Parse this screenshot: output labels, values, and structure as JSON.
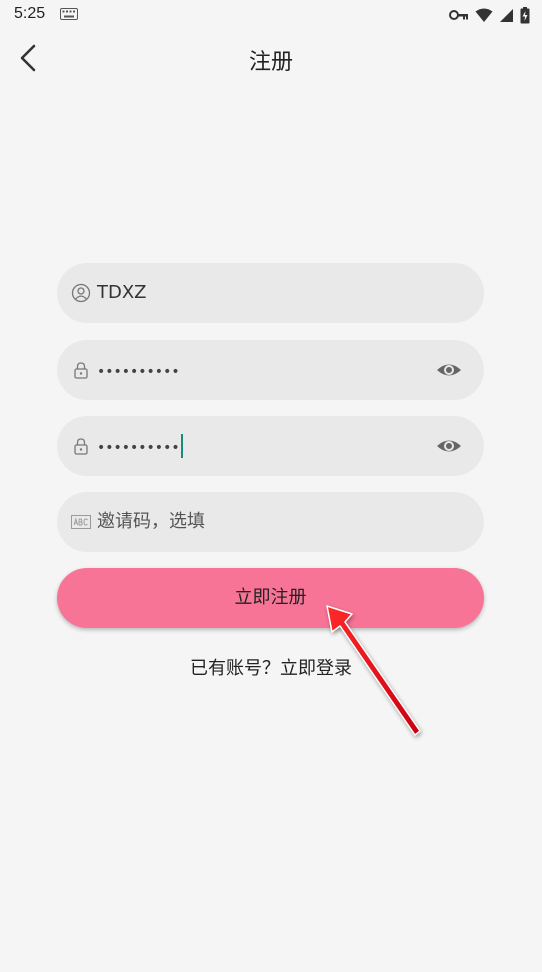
{
  "status_bar": {
    "time": "5:25"
  },
  "header": {
    "title": "注册"
  },
  "form": {
    "username_value": "TDXZ",
    "password_value": "••••••••••",
    "confirm_password_value": "••••••••••",
    "invite_placeholder": "邀请码，选填"
  },
  "actions": {
    "submit_label": "立即注册",
    "login_link_label": "已有账号？立即登录"
  },
  "colors": {
    "submit_button": "#f87497",
    "field_background": "#e9e9e9",
    "page_background": "#f5f5f5",
    "arrow": "#e8101e"
  }
}
